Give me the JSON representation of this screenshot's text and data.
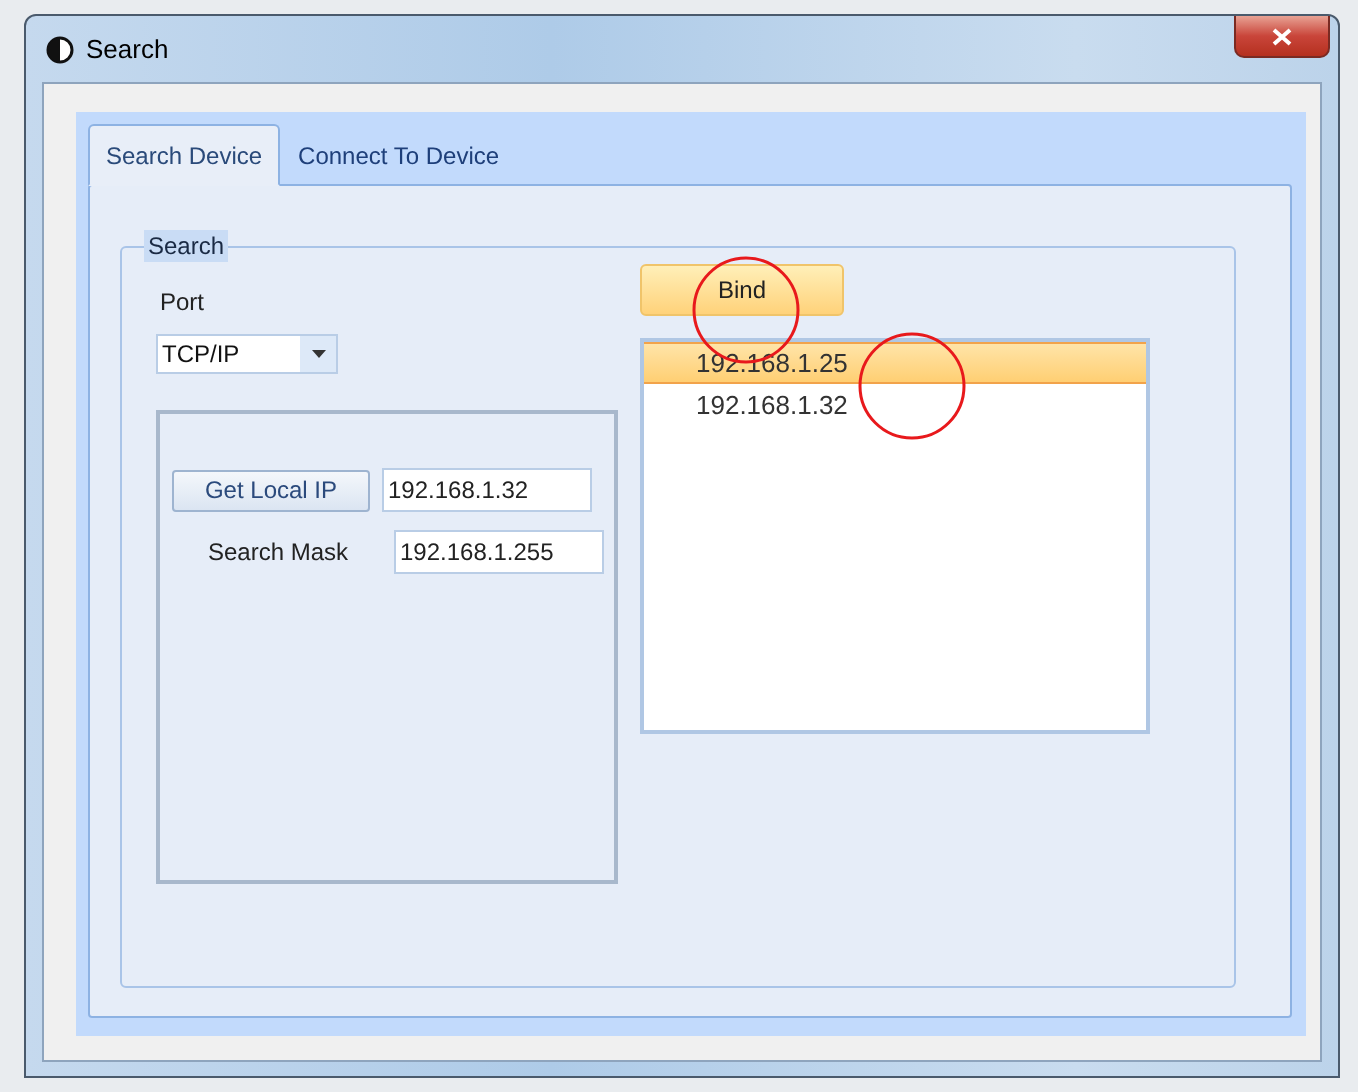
{
  "window": {
    "title": "Search"
  },
  "tabs": [
    {
      "label": "Search Device",
      "selected": true
    },
    {
      "label": "Connect To Device",
      "selected": false
    }
  ],
  "group": {
    "title": "Search"
  },
  "port": {
    "label": "Port",
    "value": "TCP/IP"
  },
  "local_ip": {
    "button": "Get Local IP",
    "value": "192.168.1.32"
  },
  "search_mask": {
    "label": "Search Mask",
    "value": "192.168.1.255"
  },
  "bind_button": "Bind",
  "devices": [
    {
      "ip": "192.168.1.25",
      "selected": true
    },
    {
      "ip": "192.168.1.32",
      "selected": false
    }
  ]
}
